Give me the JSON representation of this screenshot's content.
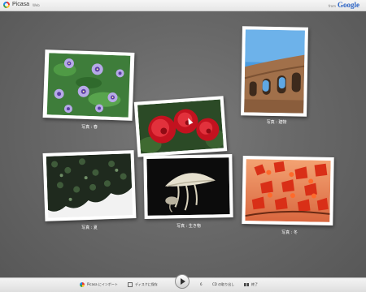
{
  "app": {
    "logo_text": "Picasa",
    "logo_sub": "Web",
    "from_text": "from",
    "brand_text": "Google"
  },
  "photos": [
    {
      "caption": "写真 : 春",
      "subject": "pansies"
    },
    {
      "caption": "写真 : 建物",
      "subject": "colosseum"
    },
    {
      "caption": "",
      "subject": "red-peonies"
    },
    {
      "caption": "写真 : 夏",
      "subject": "ivy-wall"
    },
    {
      "caption": "写真 : 生き物",
      "subject": "jellyfish"
    },
    {
      "caption": "写真 : 冬",
      "subject": "autumn-maple"
    }
  ],
  "bottombar": {
    "import_label": "Picasa にインポート",
    "disc_label": "ディスクに保存",
    "counter": "6",
    "cd_label": "CD の取り出し",
    "exit_label": "終了"
  },
  "colors": {
    "background": "#686868",
    "accent_blue": "#2b63c5"
  }
}
